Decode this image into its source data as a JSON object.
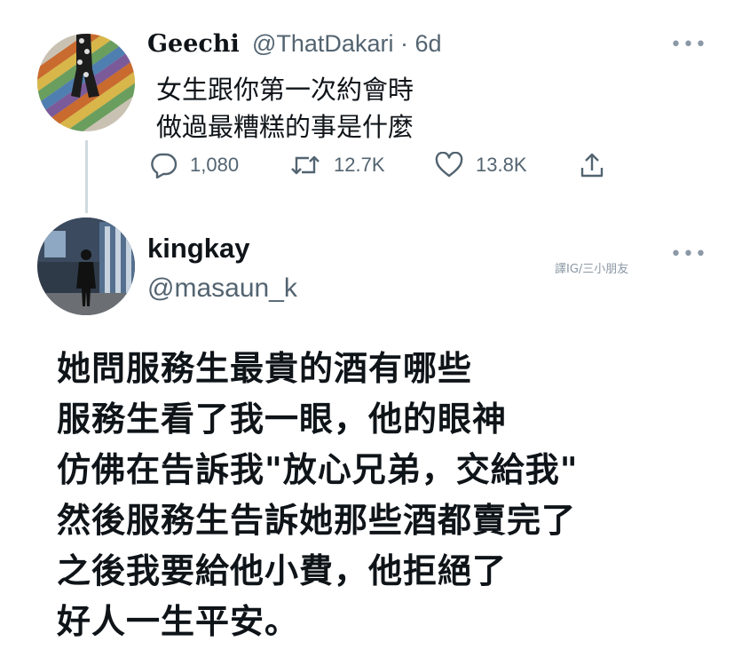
{
  "original_tweet": {
    "name": "Geechi",
    "handle": "@ThatDakari",
    "separator": "·",
    "age": "6d",
    "text_lines": [
      "女生跟你第一次約會時",
      "做過最糟糕的事是什麼"
    ],
    "more_icon": "more-dots-icon",
    "actions": {
      "replies": {
        "icon": "reply-bubble-icon",
        "count": "1,080"
      },
      "retweets": {
        "icon": "retweet-icon",
        "count": "12.7K"
      },
      "likes": {
        "icon": "heart-icon",
        "count": "13.8K"
      },
      "share": {
        "icon": "share-icon"
      }
    }
  },
  "reply_tweet": {
    "name": "kingkay",
    "handle": "@masaun_k",
    "more_icon": "more-dots-icon",
    "watermark": "譯IG/三小朋友",
    "text_lines": [
      "她問服務生最貴的酒有哪些",
      "服務生看了我一眼，他的眼神",
      "仿佛在告訴我\"放心兄弟，交給我\"",
      "然後服務生告訴她那些酒都賣完了",
      "之後我要給他小費，他拒絕了",
      "好人一生平安。"
    ]
  },
  "colors": {
    "text": "#0f1419",
    "secondary": "#536471",
    "thread_line": "#cfd9de",
    "background": "#ffffff"
  }
}
